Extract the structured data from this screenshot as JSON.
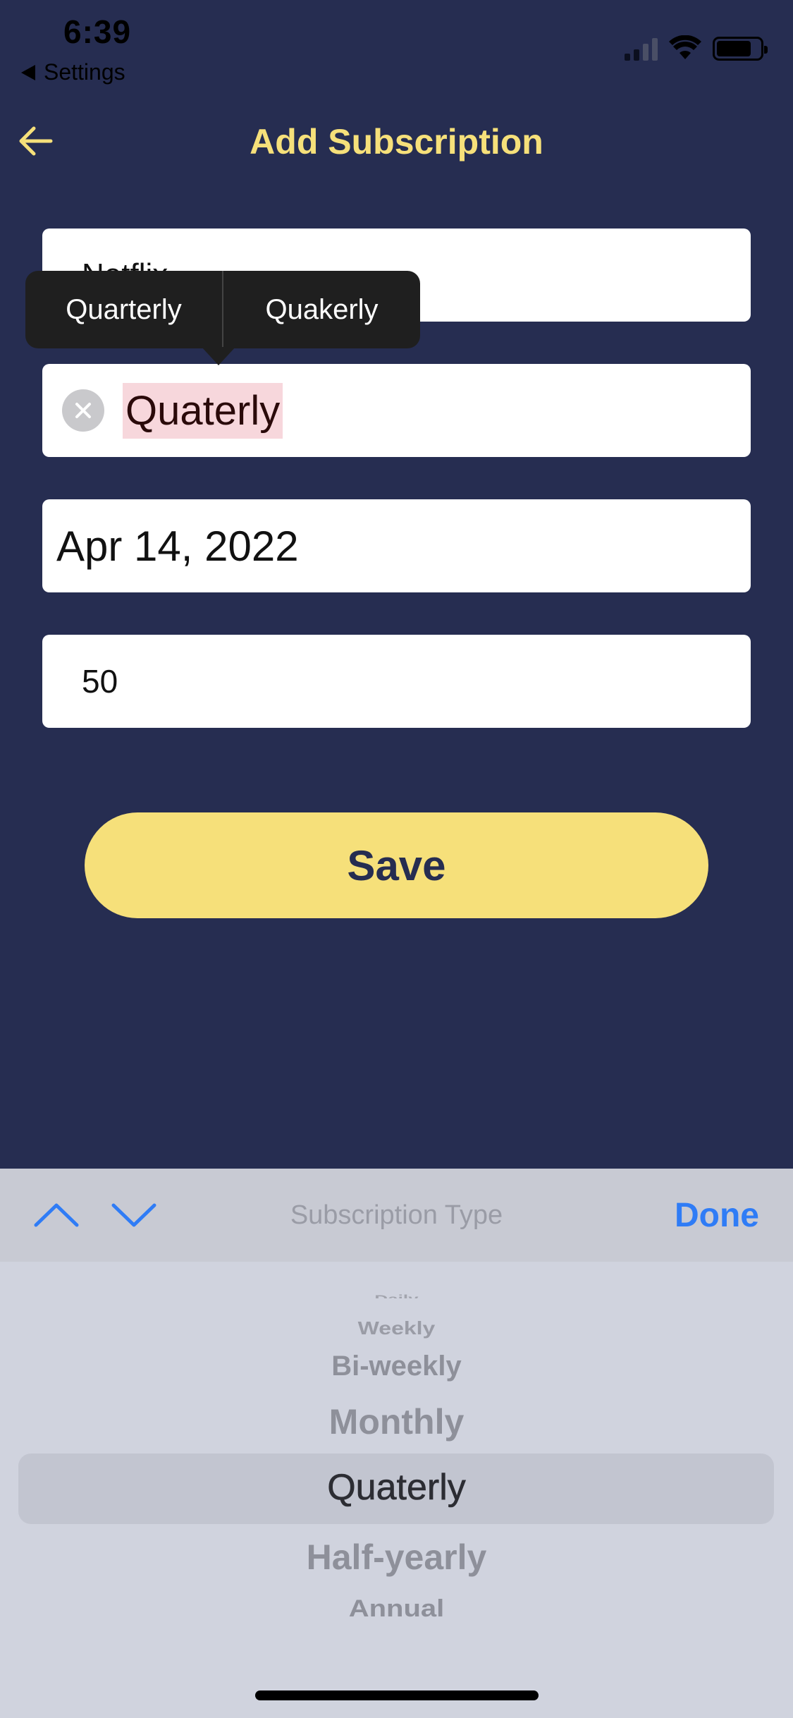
{
  "status_bar": {
    "time": "6:39",
    "back_app": "Settings"
  },
  "nav": {
    "title": "Add Subscription"
  },
  "form": {
    "name_value": "Netflix",
    "type_value": "Quaterly",
    "date_value": "Apr 14, 2022",
    "amount_value": "50",
    "save_label": "Save"
  },
  "autocorrect": {
    "options": [
      "Quarterly",
      "Quakerly"
    ]
  },
  "toolbar": {
    "title": "Subscription Type",
    "done_label": "Done"
  },
  "picker": {
    "options": [
      "Daily",
      "Weekly",
      "Bi-weekly",
      "Monthly",
      "Quaterly",
      "Half-yearly",
      "Annual"
    ],
    "selected": "Quaterly"
  },
  "colors": {
    "background": "#262d51",
    "accent": "#f6e07a",
    "done_blue": "#2f7cf6",
    "highlight": "#f7d7dc"
  },
  "icons": {
    "back": "arrow-left-icon",
    "clear": "clear-circle-icon",
    "prev": "chevron-up-icon",
    "next": "chevron-down-icon"
  }
}
